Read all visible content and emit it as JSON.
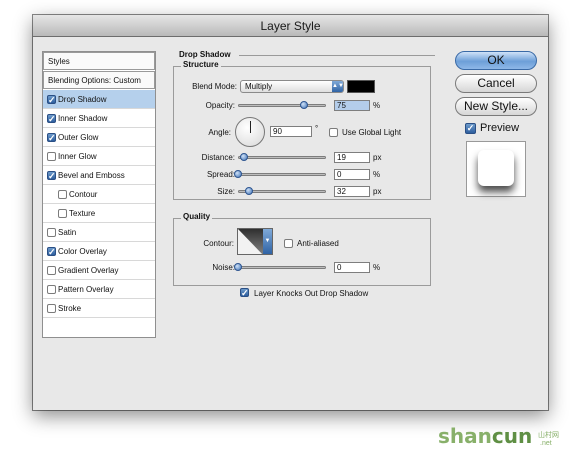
{
  "window": {
    "title": "Layer Style"
  },
  "sidebar": {
    "styles_label": "Styles",
    "blending_label": "Blending Options: Custom",
    "items": [
      {
        "label": "Drop Shadow",
        "checked": true,
        "selected": true
      },
      {
        "label": "Inner Shadow",
        "checked": true
      },
      {
        "label": "Outer Glow",
        "checked": true
      },
      {
        "label": "Inner Glow",
        "checked": false
      },
      {
        "label": "Bevel and Emboss",
        "checked": true
      },
      {
        "label": "Contour",
        "checked": false
      },
      {
        "label": "Texture",
        "checked": false
      },
      {
        "label": "Satin",
        "checked": false
      },
      {
        "label": "Color Overlay",
        "checked": true
      },
      {
        "label": "Gradient Overlay",
        "checked": false
      },
      {
        "label": "Pattern Overlay",
        "checked": false
      },
      {
        "label": "Stroke",
        "checked": false
      }
    ]
  },
  "drop_shadow": {
    "title": "Drop Shadow",
    "structure": {
      "title": "Structure",
      "blend_mode_label": "Blend Mode:",
      "blend_mode_value": "Multiply",
      "color": "#000000",
      "opacity_label": "Opacity:",
      "opacity_value": "75",
      "opacity_unit": "%",
      "opacity_level": 0.75,
      "angle_label": "Angle:",
      "angle_value": "90",
      "angle_unit": "°",
      "use_global_light_label": "Use Global Light",
      "use_global_light": false,
      "distance_label": "Distance:",
      "distance_value": "19",
      "distance_unit": "px",
      "distance_level": 0.065,
      "spread_label": "Spread:",
      "spread_value": "0",
      "spread_unit": "%",
      "spread_level": 0,
      "size_label": "Size:",
      "size_value": "32",
      "size_unit": "px",
      "size_level": 0.13
    },
    "quality": {
      "title": "Quality",
      "contour_label": "Contour:",
      "anti_aliased_label": "Anti-aliased",
      "anti_aliased": false,
      "noise_label": "Noise:",
      "noise_value": "0",
      "noise_unit": "%",
      "noise_level": 0
    },
    "knockout_label": "Layer Knocks Out Drop Shadow",
    "knockout": true
  },
  "buttons": {
    "ok": "OK",
    "cancel": "Cancel",
    "new_style": "New Style...",
    "preview_label": "Preview",
    "preview_checked": true
  },
  "watermark": {
    "text_shan": "shan",
    "text_cun": "cun",
    "text_net": ".net",
    "text_cn": "山村网"
  }
}
